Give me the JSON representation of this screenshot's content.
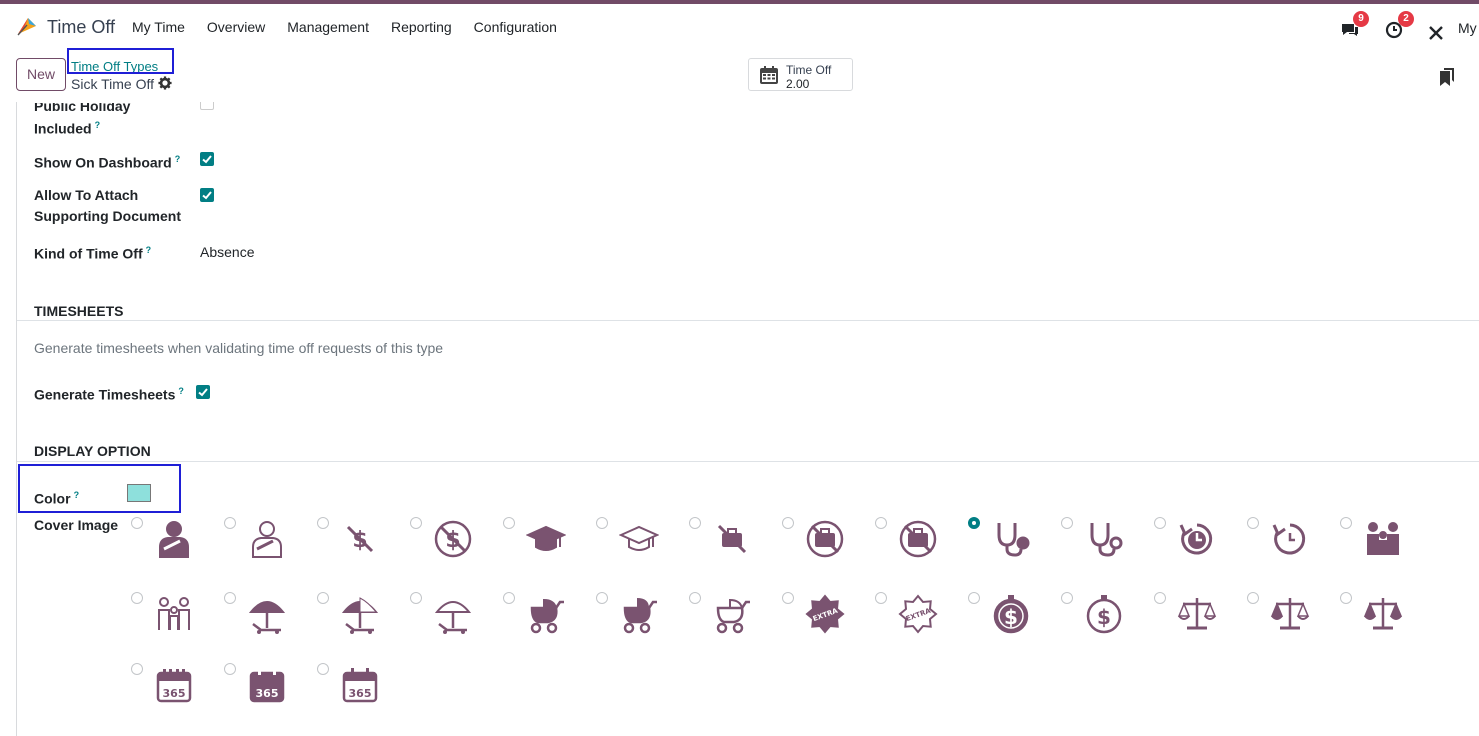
{
  "app": {
    "name": "Time Off"
  },
  "menu": [
    "My Time",
    "Overview",
    "Management",
    "Reporting",
    "Configuration"
  ],
  "systray": {
    "messages_count": "9",
    "activities_count": "2",
    "user_label": "My"
  },
  "control": {
    "new_label": "New",
    "breadcrumb_parent": "Time Off Types",
    "breadcrumb_current": "Sick Time Off",
    "stat_label": "Time Off",
    "stat_value": "2.00"
  },
  "fields": {
    "public_holiday_label_line1": "Public Holiday",
    "public_holiday_label_line2": "Included",
    "show_dashboard_label": "Show On Dashboard",
    "allow_attach_label_line1": "Allow To Attach",
    "allow_attach_label_line2": "Supporting Document",
    "kind_label": "Kind of Time Off",
    "kind_value": "Absence"
  },
  "timesheets": {
    "title": "TIMESHEETS",
    "description": "Generate timesheets when validating time off requests of this type",
    "generate_label": "Generate Timesheets"
  },
  "display": {
    "title": "DISPLAY OPTION",
    "color_label": "Color",
    "color_value": "#8ee0dc",
    "cover_label": "Cover Image"
  },
  "help_mark": "?",
  "cover_icons": [
    [
      "injured-person-filled-icon",
      "injured-person-outline-icon",
      "no-money-icon",
      "no-money-circle-icon",
      "graduation-cap-filled-icon",
      "graduation-cap-outline-icon",
      "no-briefcase-icon",
      "no-briefcase-circle-filled-icon",
      "no-briefcase-circle-outline-icon",
      "stethoscope-filled-icon",
      "stethoscope-outline-icon",
      "recycle-clock-filled-icon",
      "recycle-clock-outline-icon",
      "family-filled-icon"
    ],
    [
      "family-outline-icon",
      "beach-umbrella-filled-icon",
      "beach-umbrella-half-icon",
      "beach-umbrella-outline-icon",
      "stroller-filled-icon",
      "stroller-full-icon",
      "stroller-outline-icon",
      "extra-badge-filled-icon",
      "extra-badge-outline-icon",
      "money-clock-filled-icon",
      "money-clock-outline-icon",
      "scales-filled-icon",
      "scales-half-icon",
      "scales-outline-icon"
    ],
    [
      "calendar-365-outline-icon",
      "calendar-365-filled-icon",
      "calendar-365-grid-icon"
    ]
  ],
  "cover_selected_index": 9,
  "colors": {
    "brand": "#714b67",
    "accent": "#017e84",
    "icon": "#7a5370",
    "badge": "#e53945"
  }
}
